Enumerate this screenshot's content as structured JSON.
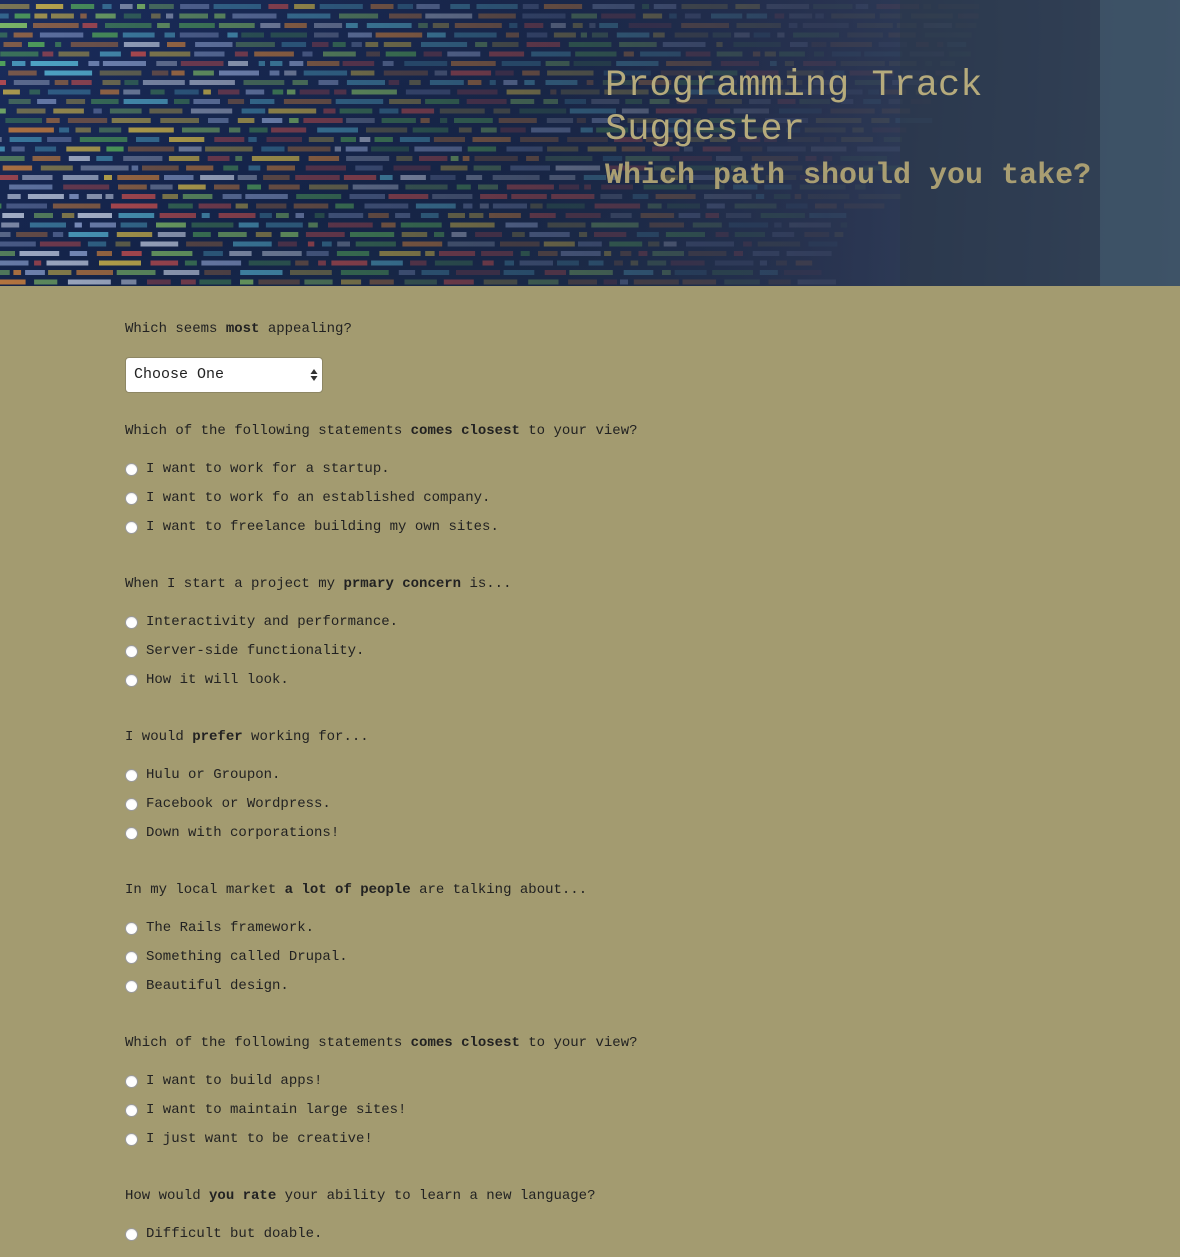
{
  "header": {
    "title": "Programming Track Suggester",
    "subtitle": "Which path should you take?"
  },
  "colors": {
    "page_background": "#a39b70",
    "title": "#b6ab7c",
    "text": "#222222"
  },
  "q1": {
    "pre": "Which seems ",
    "bold": "most",
    "post": " appealing?",
    "select_value": "Choose One"
  },
  "q2": {
    "pre": "Which of the following statements ",
    "bold": "comes closest",
    "post": " to your view?",
    "options": [
      "I want to work for a startup.",
      "I want to work fo an established company.",
      "I want to freelance building my own sites."
    ]
  },
  "q3": {
    "pre": "When I start a project my ",
    "bold": "prmary concern",
    "post": " is...",
    "options": [
      "Interactivity and performance.",
      "Server-side functionality.",
      "How it will look."
    ]
  },
  "q4": {
    "pre": "I would ",
    "bold": "prefer",
    "post": " working for...",
    "options": [
      "Hulu or Groupon.",
      "Facebook or Wordpress.",
      "Down with corporations!"
    ]
  },
  "q5": {
    "pre": "In my local market ",
    "bold": "a lot of people",
    "post": " are talking about...",
    "options": [
      "The Rails framework.",
      "Something called Drupal.",
      "Beautiful design."
    ]
  },
  "q6": {
    "pre": "Which of the following statements ",
    "bold": "comes closest",
    "post": " to your view?",
    "options": [
      "I want to build apps!",
      "I want to maintain large sites!",
      "I just want to be creative!"
    ]
  },
  "q7": {
    "pre": "How would ",
    "bold": "you rate",
    "post": " your ability to learn a new language?",
    "options": [
      "Difficult but doable."
    ]
  }
}
